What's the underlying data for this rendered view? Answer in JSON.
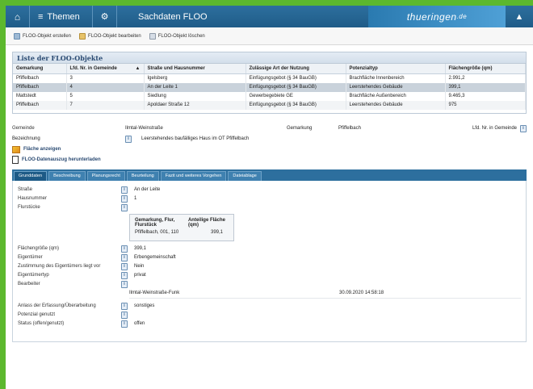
{
  "topbar": {
    "themen_label": "Themen",
    "title": "Sachdaten FLOO",
    "brand": "thueringen",
    "brand_suffix": ".de"
  },
  "toolbar": {
    "create": "FLOO-Objekt erstellen",
    "edit": "FLOO-Objekt bearbeiten",
    "delete": "FLOO-Objekt löschen"
  },
  "list": {
    "title": "Liste der FLOO-Objekte",
    "columns": [
      "Gemarkung",
      "Lfd. Nr. in Gemeinde",
      "Straße und Hausnummer",
      "Zulässige Art der Nutzung",
      "Potenzialtyp",
      "Flächengröße (qm)"
    ],
    "sort_indicator": "▲",
    "rows": [
      [
        "Pfiffelbach",
        "3",
        "Igelsberg",
        "Einfügungsgebot (§ 34 BauGB)",
        "Brachfläche Innenbereich",
        "2.991,2"
      ],
      [
        "Pfiffelbach",
        "4",
        "An der Leite 1",
        "Einfügungsgebot (§ 34 BauGB)",
        "Leerstehendes Gebäude",
        "399,1"
      ],
      [
        "Mattstedt",
        "5",
        "Siedlung",
        "Gewerbegebiete GE",
        "Brachfläche Außenbereich",
        "9.465,3"
      ],
      [
        "Pfiffelbach",
        "7",
        "Apoldaer Straße 12",
        "Einfügungsgebot (§ 34 BauGB)",
        "Leerstehendes Gebäude",
        "975"
      ]
    ],
    "selected_index": 1
  },
  "detail": {
    "gemeinde_label": "Gemeinde",
    "gemeinde_value": "Ilmtal-Weinstraße",
    "gemarkung_label": "Gemarkung",
    "gemarkung_value": "Pfiffelbach",
    "lfd_label": "Lfd. Nr. in Gemeinde",
    "bezeichnung_label": "Bezeichnung",
    "bezeichnung_value": "Leerstehendes baufälliges Haus im OT Pfiffelbach",
    "flaeche_anzeigen": "Fläche anzeigen",
    "datenauszug": "FLOO-Datenauszug herunterladen"
  },
  "tabs": [
    "Grunddaten",
    "Beschreibung",
    "Planungsrecht",
    "Beurteilung",
    "Fazit und weiteres Vorgehen",
    "Dateiablage"
  ],
  "grunddaten": {
    "strasse_label": "Straße",
    "strasse_value": "An der Leite",
    "hausnummer_label": "Hausnummer",
    "hausnummer_value": "1",
    "flurstuecke_label": "Flurstücke",
    "sub_col1": "Gemarkung, Flur, Flurstück",
    "sub_col2": "Anteilige Fläche (qm)",
    "sub_row_col1": "Pfiffelbach, 001, 110",
    "sub_row_col2": "399,1",
    "flaechengroesse_label": "Flächengröße (qm)",
    "flaechengroesse_value": "399,1",
    "eigentuemer_label": "Eigentümer",
    "eigentuemer_value": "Erbengemeinschaft",
    "zustimmung_label": "Zustimmung des Eigentümers liegt vor",
    "zustimmung_value": "Nein",
    "eigentuemertyp_label": "Eigentümertyp",
    "eigentuemertyp_value": "privat",
    "bearbeiter_label": "Bearbeiter",
    "bearbeiter_name": "Ilmtal-Weinstraße-Funk",
    "bearbeiter_date": "30.09.2020 14:58:18",
    "anlass_label": "Anlass der Erfassung/Überarbeitung",
    "anlass_value": "sonstiges",
    "potenzial_label": "Potenzial genutzt",
    "potenzial_value": "",
    "status_label": "Status (offen/genutzt)",
    "status_value": "offen"
  }
}
